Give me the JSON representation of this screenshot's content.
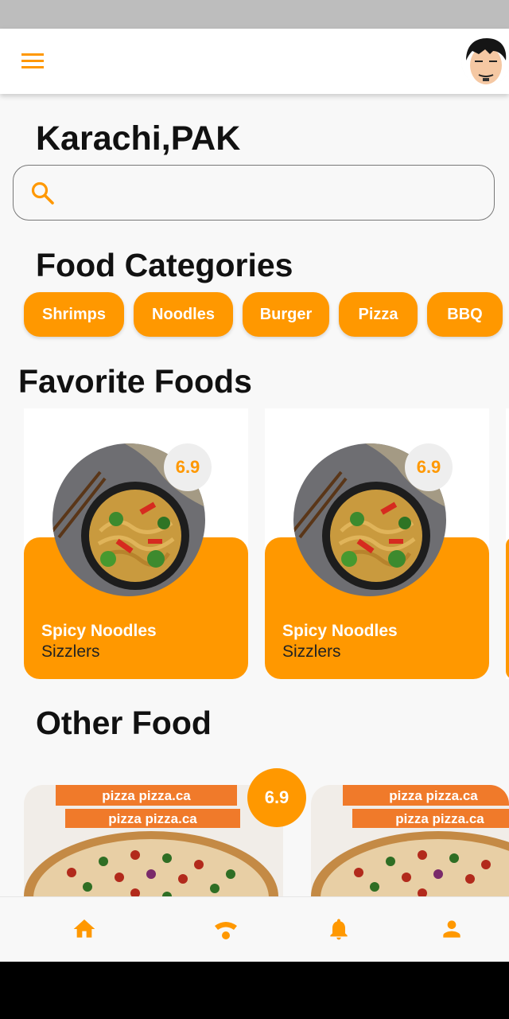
{
  "header": {
    "location": "Karachi,PAK"
  },
  "search": {
    "placeholder": ""
  },
  "categories": {
    "title": "Food Categories",
    "items": [
      "Shrimps",
      "Noodles",
      "Burger",
      "Pizza",
      "BBQ"
    ]
  },
  "favorites": {
    "title": "Favorite Foods",
    "items": [
      {
        "name": "Spicy Noodles",
        "subtitle": "Sizzlers",
        "rating": "6.9"
      },
      {
        "name": "Spicy Noodles",
        "subtitle": "Sizzlers",
        "rating": "6.9"
      }
    ]
  },
  "other": {
    "title": "Other Food",
    "rating": "6.9",
    "box_text": "pizza pizza.ca"
  },
  "bottom_nav": [
    "home-icon",
    "wifi-icon",
    "bell-icon",
    "person-icon"
  ],
  "colors": {
    "accent": "#ff9800",
    "background": "#f8f8f8",
    "text": "#111111"
  }
}
